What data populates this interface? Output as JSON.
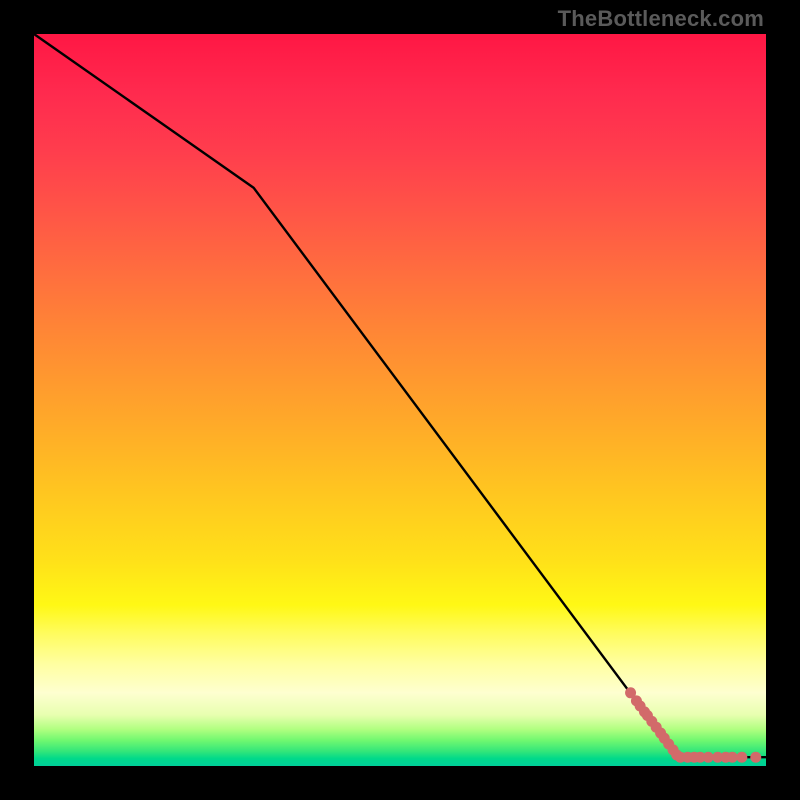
{
  "watermark": "TheBottleneck.com",
  "chart_data": {
    "type": "line",
    "title": "",
    "xlabel": "",
    "ylabel": "",
    "xlim": [
      0,
      100
    ],
    "ylim": [
      0,
      100
    ],
    "grid": false,
    "curve": {
      "x": [
        0,
        30,
        88,
        100
      ],
      "y": [
        100,
        79,
        1.2,
        1.2
      ]
    },
    "markers": {
      "color": "#d26a6a",
      "points": [
        {
          "x": 81.5,
          "y": 10.0
        },
        {
          "x": 82.3,
          "y": 8.9
        },
        {
          "x": 82.8,
          "y": 8.2
        },
        {
          "x": 83.4,
          "y": 7.4
        },
        {
          "x": 83.8,
          "y": 6.9
        },
        {
          "x": 84.4,
          "y": 6.1
        },
        {
          "x": 85.0,
          "y": 5.3
        },
        {
          "x": 85.6,
          "y": 4.5
        },
        {
          "x": 86.1,
          "y": 3.8
        },
        {
          "x": 86.7,
          "y": 3.0
        },
        {
          "x": 87.3,
          "y": 2.2
        },
        {
          "x": 87.8,
          "y": 1.5
        },
        {
          "x": 88.3,
          "y": 1.2
        },
        {
          "x": 89.3,
          "y": 1.2
        },
        {
          "x": 90.2,
          "y": 1.2
        },
        {
          "x": 91.0,
          "y": 1.2
        },
        {
          "x": 92.1,
          "y": 1.2
        },
        {
          "x": 93.4,
          "y": 1.2
        },
        {
          "x": 94.5,
          "y": 1.2
        },
        {
          "x": 95.4,
          "y": 1.2
        },
        {
          "x": 96.7,
          "y": 1.2
        },
        {
          "x": 98.6,
          "y": 1.2
        }
      ]
    }
  }
}
